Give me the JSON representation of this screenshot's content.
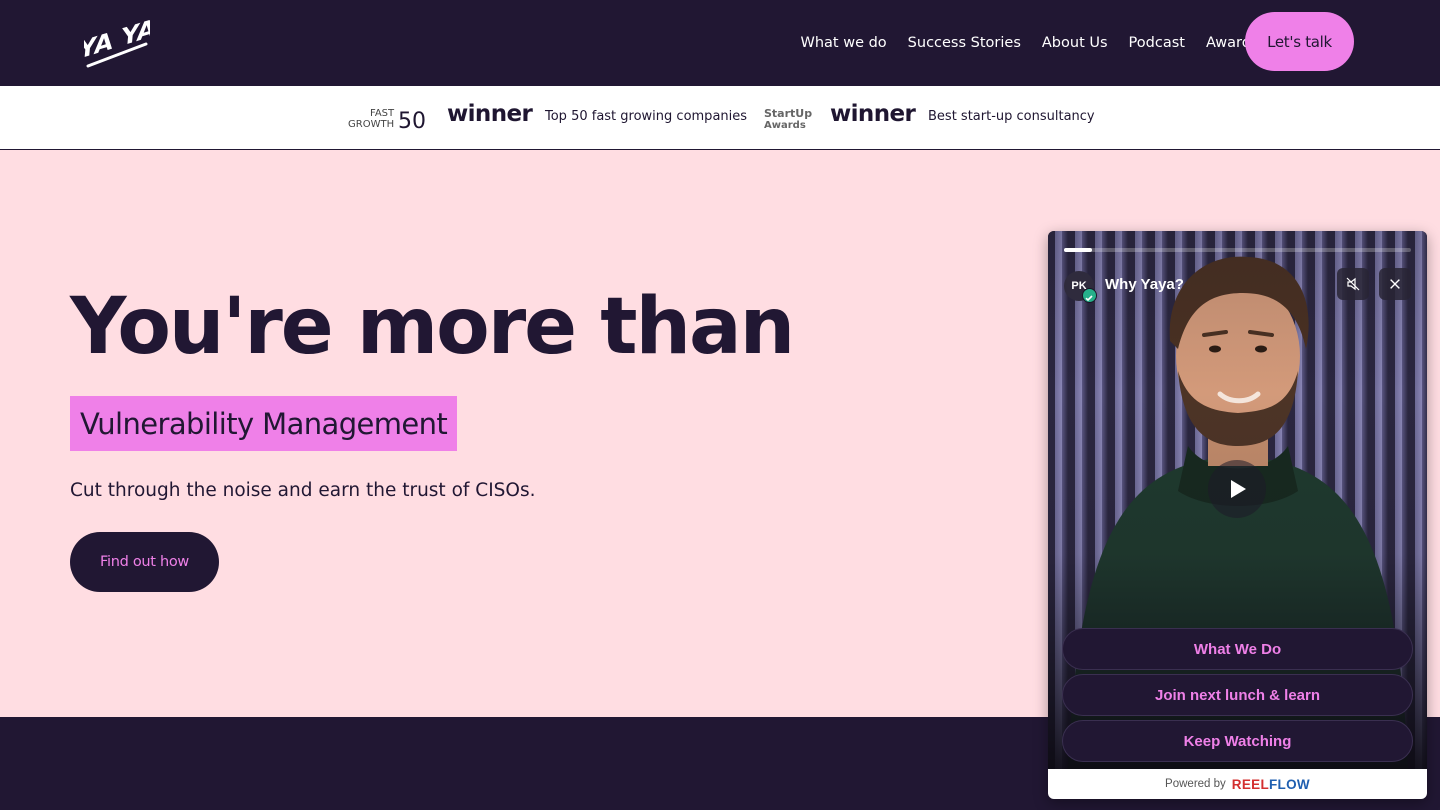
{
  "nav": {
    "links": [
      "What we do",
      "Success Stories",
      "About Us",
      "Podcast",
      "Awards"
    ],
    "cta": "Let's talk",
    "logo_text": "YA YA"
  },
  "awards": {
    "fast_growth_logo": "FAST GROWTH 50",
    "winner_1": "winner",
    "text_1": "Top 50 fast growing companies",
    "startup_logo": "StartUp Awards",
    "winner_2": "winner",
    "text_2": "Best start-up consultancy"
  },
  "hero": {
    "title": "You're more than",
    "highlight": "Vulnerability Management",
    "subtitle": "Cut through the noise and earn the trust of CISOs.",
    "cta": "Find out how"
  },
  "widget": {
    "avatar_initials": "PK",
    "title": "Why Yaya?",
    "progress": 0.08,
    "buttons": [
      "What We Do",
      "Join next lunch & learn",
      "Keep Watching"
    ],
    "powered_by": "Powered by",
    "brand_part1": "REEL",
    "brand_part2": "FLOW"
  },
  "colors": {
    "dark": "#211733",
    "pink_accent": "#ef80e8",
    "hero_bg": "#ffdde2"
  }
}
